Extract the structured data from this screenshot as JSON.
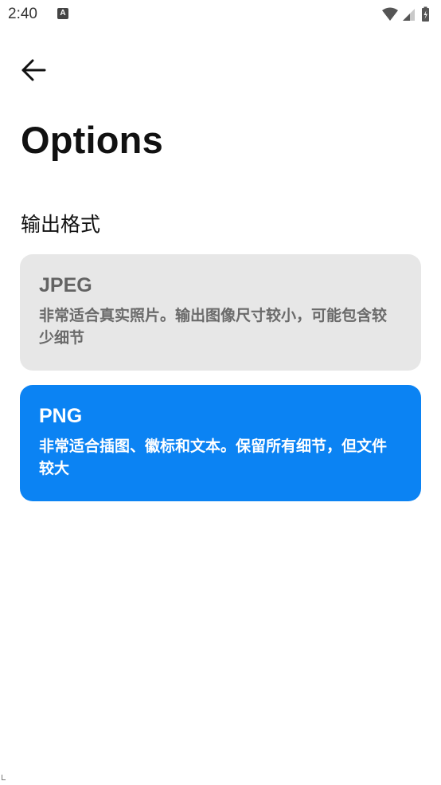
{
  "status_bar": {
    "time": "2:40",
    "notification_icon": "A",
    "icons": [
      "wifi-icon",
      "signal-icon",
      "battery-icon"
    ]
  },
  "header": {
    "back_icon": "arrow-left-icon",
    "title": "Options"
  },
  "section": {
    "heading": "输出格式"
  },
  "options": [
    {
      "name": "JPEG",
      "description": "非常适合真实照片。输出图像尺寸较小，可能包含较少细节",
      "selected": false,
      "background": "#e7e7e7"
    },
    {
      "name": "PNG",
      "description": "非常适合插图、徽标和文本。保留所有细节，但文件较大",
      "selected": true,
      "background": "#0b83f3"
    }
  ],
  "colors": {
    "accent": "#0b83f3",
    "unselected_card": "#e7e7e7",
    "text": "#111111"
  }
}
